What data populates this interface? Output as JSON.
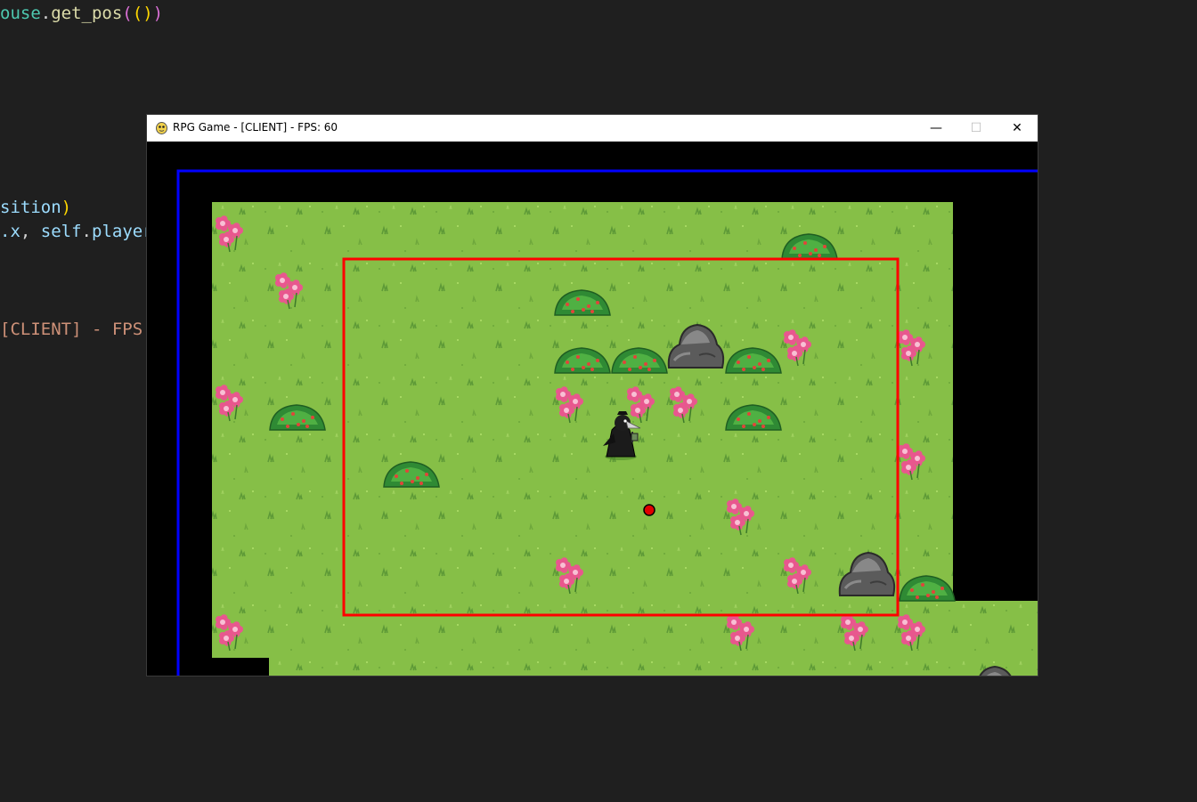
{
  "editor": {
    "lines": [
      {
        "segments": [
          {
            "t": "ouse",
            "c": "tok-id"
          },
          {
            "t": ".",
            "c": "tok-punc"
          },
          {
            "t": "get_pos",
            "c": "tok-fn"
          },
          {
            "t": "(",
            "c": "tok-p1"
          },
          {
            "t": "(",
            "c": "tok-p2"
          },
          {
            "t": ")",
            "c": "tok-p2"
          },
          {
            "t": ")",
            "c": "tok-p1"
          }
        ]
      },
      {
        "segments": [
          {
            "t": "sition",
            "c": "tok-var"
          },
          {
            "t": ")",
            "c": "tok-p2"
          }
        ]
      },
      {
        "segments": [
          {
            "t": ".x",
            "c": "tok-var"
          },
          {
            "t": ", ",
            "c": "tok-punc"
          },
          {
            "t": "self",
            "c": "tok-var"
          },
          {
            "t": ".",
            "c": "tok-punc"
          },
          {
            "t": "player",
            "c": "tok-var"
          }
        ]
      },
      {
        "segments": [
          {
            "t": "[CLIENT] - FPS:",
            "c": "tok-str"
          }
        ]
      }
    ]
  },
  "window": {
    "title": "RPG Game - [CLIENT] - FPS: 60",
    "icon": "pygame-snake-icon",
    "controls": {
      "minimize": "—",
      "maximize": "☐",
      "close": "✕"
    }
  },
  "scene": {
    "ground_color": "#86bf47",
    "blue_boundary_color": "#0000ff",
    "red_camera_box_color": "#ff0000",
    "player": "plague-doctor-character",
    "target_marker": "red-dot",
    "objects": [
      "flower",
      "bush",
      "rock"
    ]
  }
}
